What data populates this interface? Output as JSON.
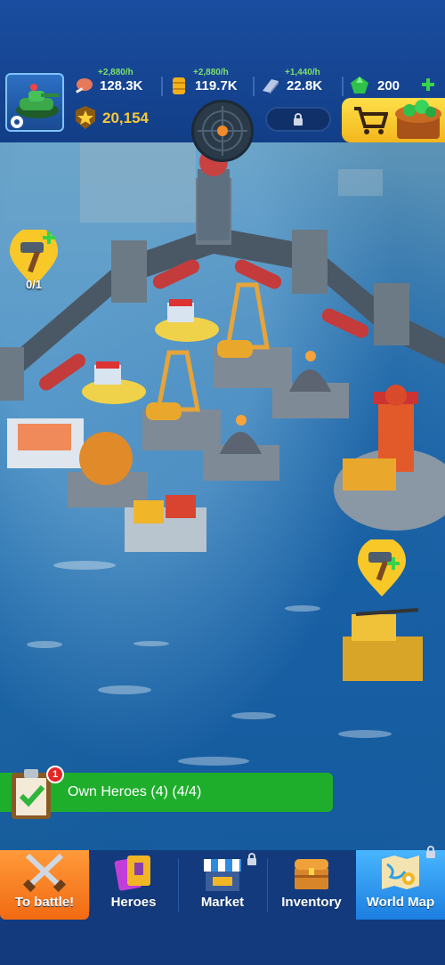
{
  "resources": [
    {
      "name": "meat",
      "rate": "+2,880/h",
      "value": "128.3K",
      "icon": "meat-icon",
      "color": "#e8785a"
    },
    {
      "name": "oil",
      "rate": "+2,880/h",
      "value": "119.7K",
      "icon": "oil-barrel-icon",
      "color": "#f2b019"
    },
    {
      "name": "steel",
      "rate": "+1,440/h",
      "value": "22.8K",
      "icon": "steel-bar-icon",
      "color": "#b9c8e6"
    },
    {
      "name": "gems",
      "value": "200",
      "icon": "gem-icon",
      "color": "#2ec24a"
    }
  ],
  "rank": {
    "value": "20,154",
    "icon": "star-badge-icon"
  },
  "mission": {
    "text": "Own Heroes (4)  (4/4)",
    "badge": "1"
  },
  "build_pin": {
    "count": "0/1"
  },
  "nav": [
    {
      "label": "To battle!",
      "icon": "crossed-swords-icon"
    },
    {
      "label": "Heroes",
      "icon": "hero-cards-icon"
    },
    {
      "label": "Market",
      "icon": "market-stall-icon",
      "locked": true
    },
    {
      "label": "Inventory",
      "icon": "treasure-chest-icon"
    },
    {
      "label": "World Map",
      "icon": "world-map-icon",
      "locked": true
    }
  ],
  "colors": {
    "accent_green": "#1fae2c",
    "battle_orange": "#f26a12",
    "map_blue": "#1c7ee0",
    "rank_gold": "#f8c838"
  }
}
